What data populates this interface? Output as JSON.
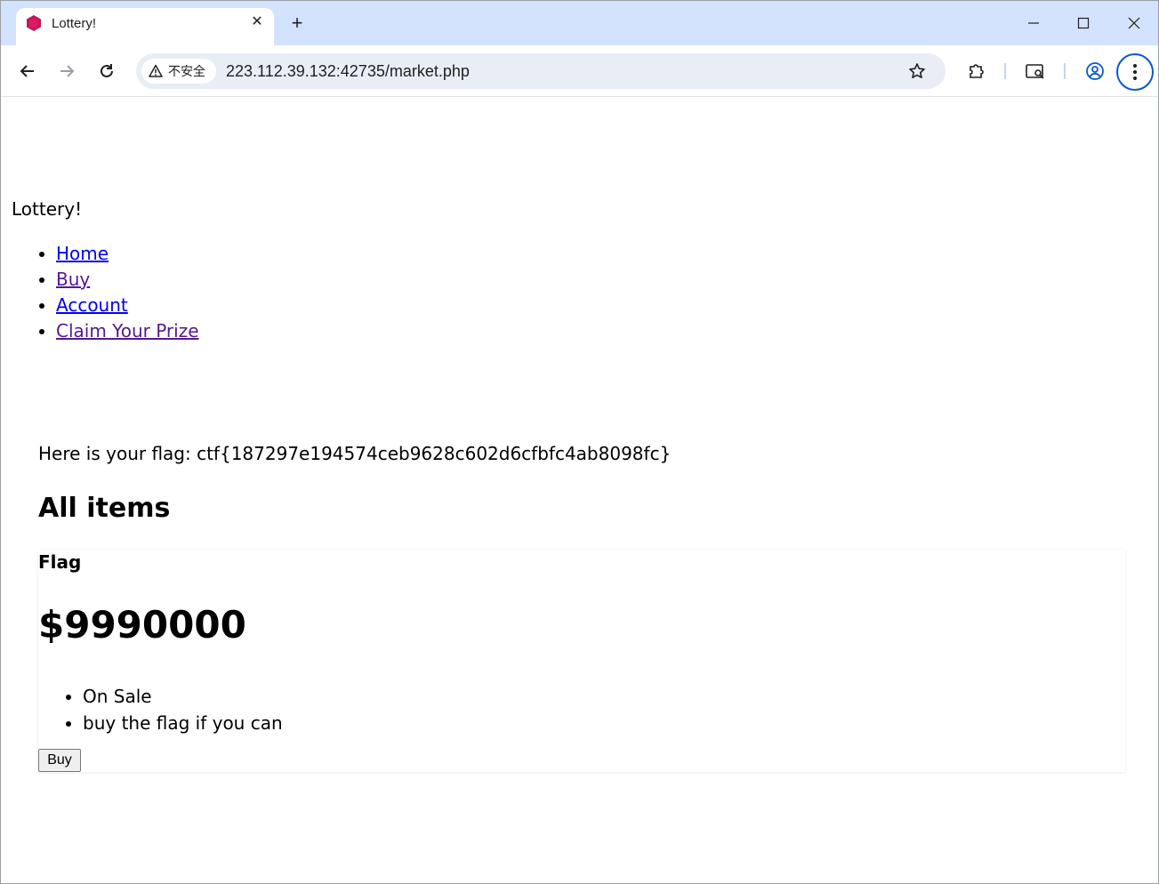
{
  "browser": {
    "tab": {
      "title": "Lottery!",
      "favicon": "hexagon-icon",
      "favicon_color": "#c2185b"
    },
    "toolbar": {
      "security_label": "不安全",
      "url": "223.112.39.132:42735/market.php"
    },
    "accent_color": "#0b57d0"
  },
  "site": {
    "title": "Lottery!",
    "nav": [
      {
        "label": "Home",
        "visited": false
      },
      {
        "label": "Buy",
        "visited": true
      },
      {
        "label": "Account",
        "visited": false
      },
      {
        "label": "Claim Your Prize",
        "visited": true
      }
    ]
  },
  "main": {
    "flag_message": "Here is your flag: ctf{187297e194574ceb9628c602d6cfbfc4ab8098fc}",
    "section_title": "All items",
    "items": [
      {
        "name": "Flag",
        "price": "$9990000",
        "tags": [
          "On Sale",
          "buy the flag if you can"
        ],
        "buy_label": "Buy"
      }
    ]
  }
}
